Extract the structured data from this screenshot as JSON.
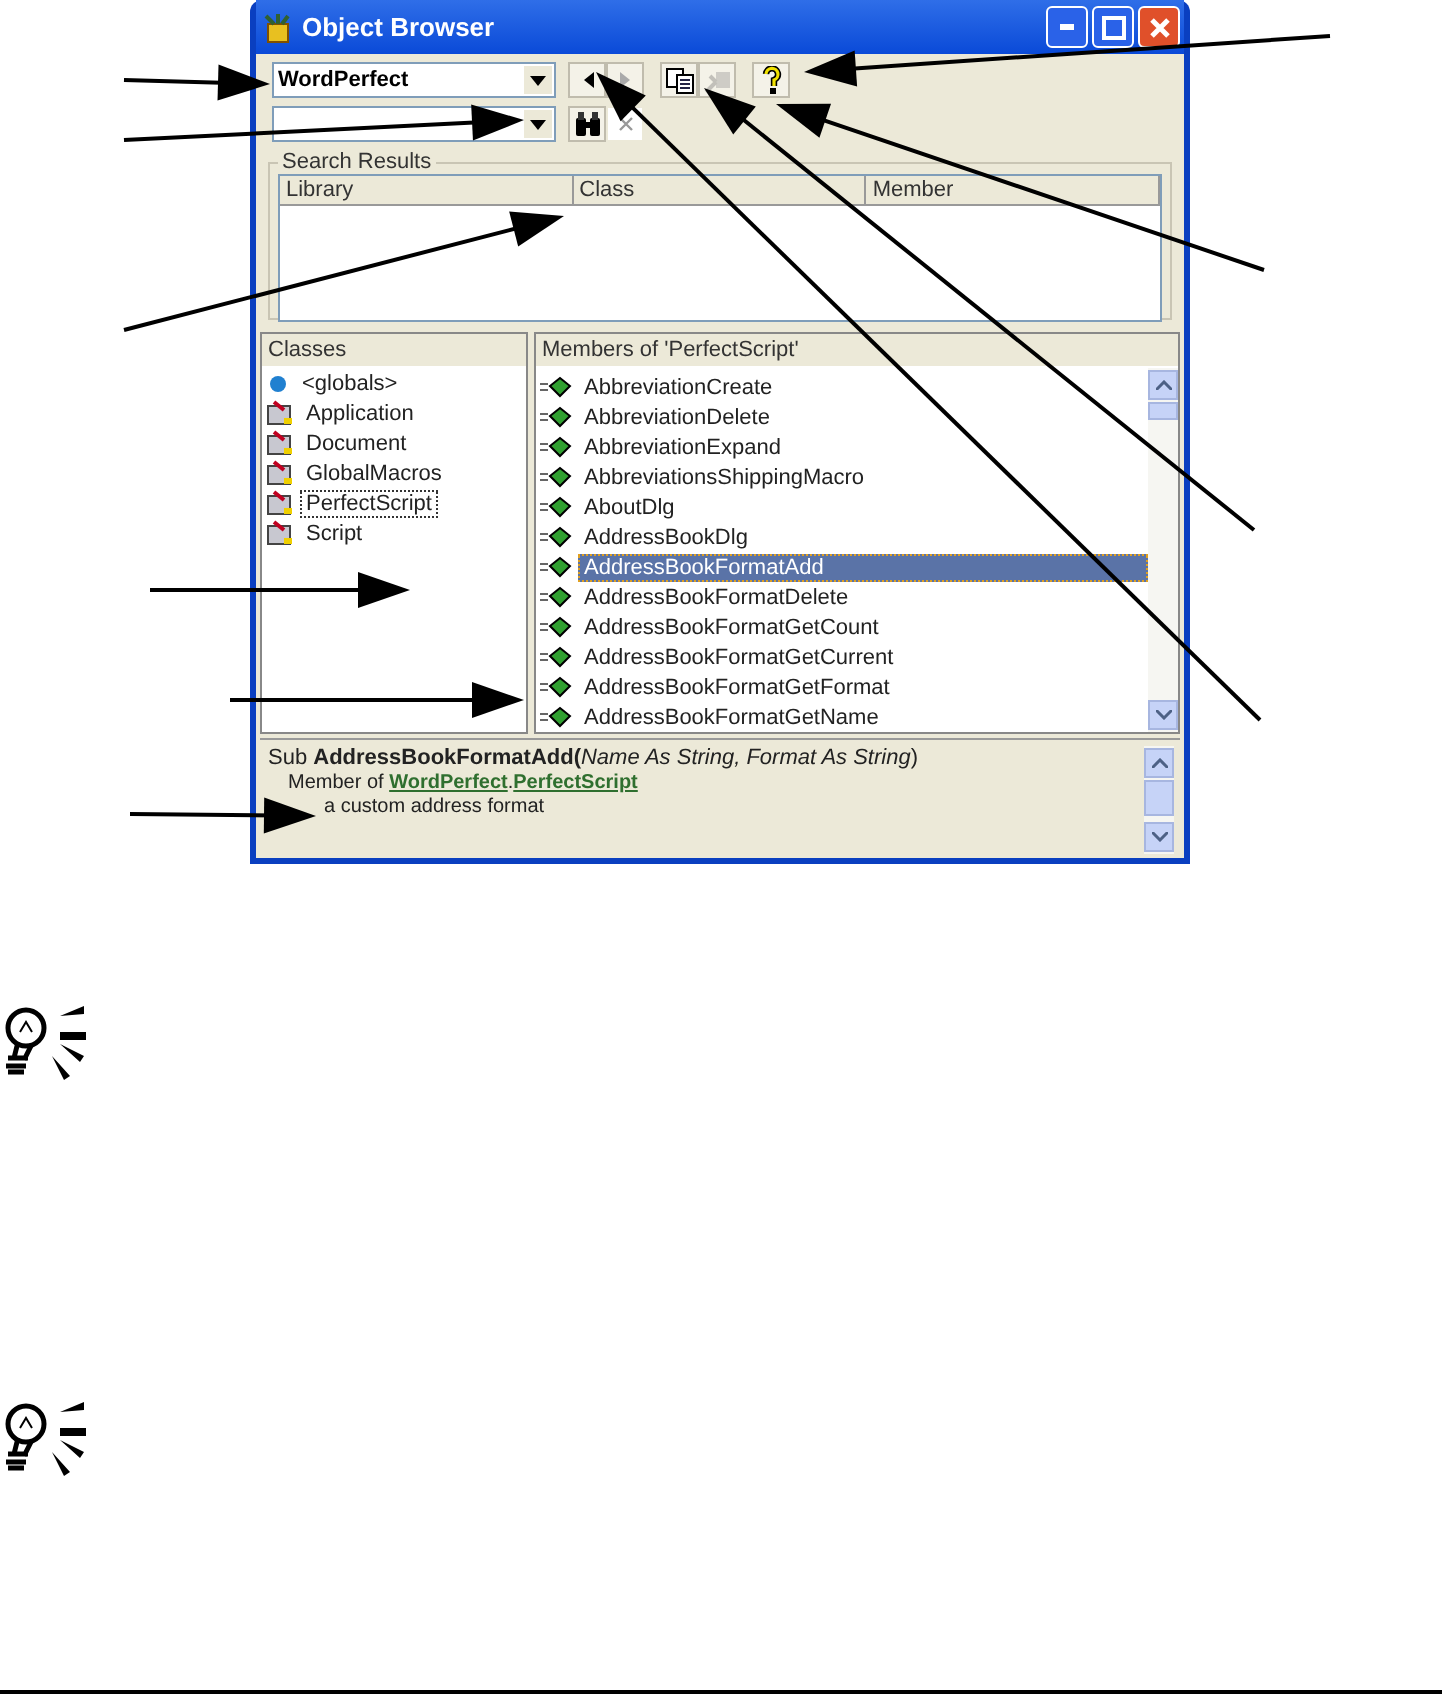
{
  "window": {
    "title": "Object Browser"
  },
  "toolbar": {
    "library": "WordPerfect",
    "back_disabled": false,
    "forward_disabled": true,
    "copy_disabled": false,
    "view_definition_disabled": true
  },
  "search_results": {
    "title": "Search Results",
    "columns": [
      "Library",
      "Class",
      "Member"
    ]
  },
  "classes": {
    "header": "Classes",
    "items": [
      {
        "name": "<globals>",
        "kind": "globals",
        "selected": false
      },
      {
        "name": "Application",
        "kind": "class",
        "selected": false
      },
      {
        "name": "Document",
        "kind": "class",
        "selected": false
      },
      {
        "name": "GlobalMacros",
        "kind": "class",
        "selected": false
      },
      {
        "name": "PerfectScript",
        "kind": "class",
        "selected": true
      },
      {
        "name": "Script",
        "kind": "class",
        "selected": false
      }
    ]
  },
  "members": {
    "header": "Members of 'PerfectScript'",
    "items": [
      {
        "name": "AbbreviationCreate",
        "selected": false
      },
      {
        "name": "AbbreviationDelete",
        "selected": false
      },
      {
        "name": "AbbreviationExpand",
        "selected": false
      },
      {
        "name": "AbbreviationsShippingMacro",
        "selected": false
      },
      {
        "name": "AboutDlg",
        "selected": false
      },
      {
        "name": "AddressBookDlg",
        "selected": false
      },
      {
        "name": "AddressBookFormatAdd",
        "selected": true
      },
      {
        "name": "AddressBookFormatDelete",
        "selected": false
      },
      {
        "name": "AddressBookFormatGetCount",
        "selected": false
      },
      {
        "name": "AddressBookFormatGetCurrent",
        "selected": false
      },
      {
        "name": "AddressBookFormatGetFormat",
        "selected": false
      },
      {
        "name": "AddressBookFormatGetName",
        "selected": false
      }
    ]
  },
  "description": {
    "signature": {
      "keyword": "Sub",
      "name": "AddressBookFormatAdd(",
      "params": "Name As String, Format As String",
      "close": ")"
    },
    "member_of": "Member of",
    "library_link": "WordPerfect",
    "separator": ".",
    "class_link": "PerfectScript",
    "summary": "a custom address format"
  }
}
